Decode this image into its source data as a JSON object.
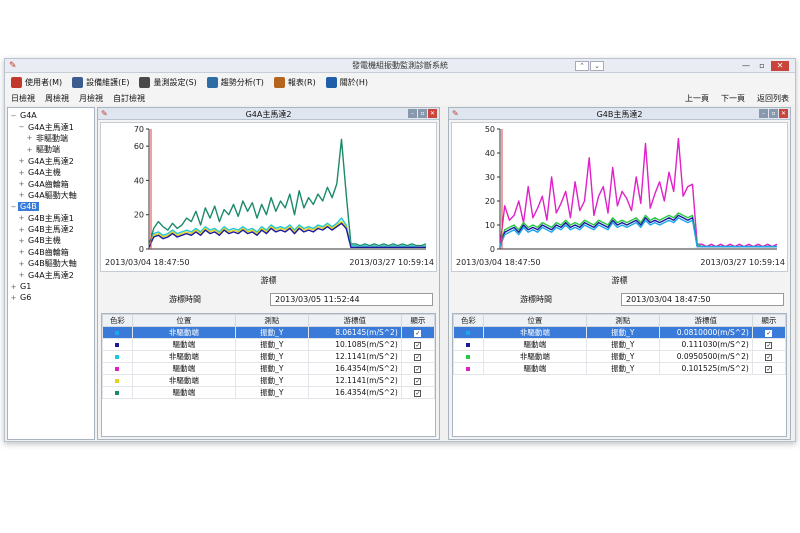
{
  "window": {
    "title": "發電機組振動監測診斷系統",
    "controls": {
      "minimize": "—",
      "restore": "▫",
      "close": "✕"
    }
  },
  "menu": [
    {
      "label": "使用者(M)",
      "icon": "user-icon",
      "color": "#c0392b"
    },
    {
      "label": "設備維護(E)",
      "icon": "monitor-icon",
      "color": "#3b5c8f"
    },
    {
      "label": "量測設定(S)",
      "icon": "settings-icon",
      "color": "#4a4a4a"
    },
    {
      "label": "趨勢分析(T)",
      "icon": "trend-icon",
      "color": "#2e6da4"
    },
    {
      "label": "報表(R)",
      "icon": "report-icon",
      "color": "#b5651d"
    },
    {
      "label": "關於(H)",
      "icon": "info-icon",
      "color": "#1f5fa8"
    }
  ],
  "toolbar": {
    "left": [
      "日檢視",
      "周檢視",
      "月檢視",
      "自訂檢視"
    ],
    "right": [
      "上一頁",
      "下一頁",
      "返回列表"
    ]
  },
  "tree": [
    {
      "label": "G4A",
      "level": 0,
      "exp": "−"
    },
    {
      "label": "G4A主馬達1",
      "level": 1,
      "exp": "−"
    },
    {
      "label": "非驅動端",
      "level": 2,
      "exp": "+"
    },
    {
      "label": "驅動端",
      "level": 2,
      "exp": "+"
    },
    {
      "label": "G4A主馬達2",
      "level": 1,
      "exp": "+"
    },
    {
      "label": "G4A主機",
      "level": 1,
      "exp": "+"
    },
    {
      "label": "G4A齒輪箱",
      "level": 1,
      "exp": "+"
    },
    {
      "label": "G4A驅動大軸",
      "level": 1,
      "exp": "+"
    },
    {
      "label": "G4B",
      "level": 0,
      "exp": "−",
      "selected": true
    },
    {
      "label": "G4B主馬達1",
      "level": 1,
      "exp": "+"
    },
    {
      "label": "G4B主馬達2",
      "level": 1,
      "exp": "+"
    },
    {
      "label": "G4B主機",
      "level": 1,
      "exp": "+"
    },
    {
      "label": "G4B齒輪箱",
      "level": 1,
      "exp": "+"
    },
    {
      "label": "G4B驅動大軸",
      "level": 1,
      "exp": "+"
    },
    {
      "label": "G4A主馬達2",
      "level": 1,
      "exp": "+"
    },
    {
      "label": "G1",
      "level": 0,
      "exp": "+"
    },
    {
      "label": "G6",
      "level": 0,
      "exp": "+"
    }
  ],
  "panels": [
    {
      "title": "G4A主馬達2",
      "cursor_label": "游標",
      "cursor_time_label": "游標時間",
      "cursor_time": "2013/03/05 11:52:44",
      "columns": [
        "色彩",
        "位置",
        "測點",
        "游標值",
        "顯示"
      ],
      "rows": [
        {
          "color": "#1ea7e8",
          "position": "非驅動端",
          "point": "振動_Y",
          "value": "8.06145(m/S^2)",
          "checked": true,
          "selected": true
        },
        {
          "color": "#1a1aa0",
          "position": "驅動端",
          "point": "振動_Y",
          "value": "10.1085(m/S^2)",
          "checked": true
        },
        {
          "color": "#1ec8d8",
          "position": "非驅動端",
          "point": "振動_Y",
          "value": "12.1141(m/S^2)",
          "checked": true
        },
        {
          "color": "#e020c8",
          "position": "驅動端",
          "point": "振動_Y",
          "value": "16.4354(m/S^2)",
          "checked": true
        },
        {
          "color": "#e8d020",
          "position": "非驅動端",
          "point": "振動_Y",
          "value": "12.1141(m/S^2)",
          "checked": true
        },
        {
          "color": "#1a8a6a",
          "position": "驅動端",
          "point": "振動_Y",
          "value": "16.4354(m/S^2)",
          "checked": true
        }
      ]
    },
    {
      "title": "G4B主馬達2",
      "cursor_label": "游標",
      "cursor_time_label": "游標時間",
      "cursor_time": "2013/03/04 18:47:50",
      "columns": [
        "色彩",
        "位置",
        "測點",
        "游標值",
        "顯示"
      ],
      "rows": [
        {
          "color": "#1ea7e8",
          "position": "非驅動端",
          "point": "振動_Y",
          "value": "0.0810000(m/S^2)",
          "checked": true,
          "selected": true
        },
        {
          "color": "#1a1aa0",
          "position": "驅動端",
          "point": "振動_Y",
          "value": "0.111030(m/S^2)",
          "checked": true
        },
        {
          "color": "#28c840",
          "position": "非驅動端",
          "point": "振動_Y",
          "value": "0.0950500(m/S^2)",
          "checked": true
        },
        {
          "color": "#e020c8",
          "position": "驅動端",
          "point": "振動_Y",
          "value": "0.101525(m/S^2)",
          "checked": true
        }
      ]
    }
  ],
  "chart_data": [
    {
      "type": "line",
      "title": "G4A主馬達2",
      "ylim": [
        0,
        70
      ],
      "yticks": [
        0,
        20,
        40,
        60,
        70
      ],
      "xlim": [
        "2013/03/04 18:47:50",
        "2013/03/27 10:59:14"
      ],
      "cursor_x": 0.0,
      "grid": false,
      "series": [
        {
          "color": "#1a8a6a",
          "values": [
            2,
            12,
            16,
            13,
            11,
            15,
            12,
            14,
            18,
            16,
            22,
            14,
            24,
            18,
            25,
            16,
            23,
            20,
            26,
            19,
            28,
            22,
            27,
            18,
            26,
            20,
            30,
            22,
            28,
            24,
            32,
            20,
            34,
            24,
            30,
            26,
            32,
            28,
            36,
            30,
            38,
            64,
            32,
            3,
            3,
            2,
            3,
            2,
            3,
            2,
            3,
            2,
            3,
            2,
            3,
            2,
            3,
            2,
            2,
            3
          ]
        },
        {
          "color": "#1ec8d8",
          "values": [
            1,
            9,
            10,
            8,
            9,
            11,
            9,
            10,
            11,
            10,
            12,
            10,
            13,
            11,
            12,
            10,
            13,
            11,
            12,
            11,
            13,
            11,
            12,
            10,
            13,
            11,
            14,
            12,
            13,
            12,
            14,
            11,
            14,
            12,
            13,
            12,
            14,
            13,
            15,
            13,
            15,
            18,
            14,
            2,
            2,
            1,
            2,
            1,
            2,
            1,
            2,
            1,
            2,
            1,
            2,
            1,
            2,
            1,
            1,
            2
          ]
        },
        {
          "color": "#e8d020",
          "values": [
            1,
            8,
            9,
            7,
            8,
            10,
            8,
            9,
            10,
            9,
            11,
            9,
            12,
            10,
            11,
            9,
            12,
            10,
            11,
            10,
            12,
            10,
            11,
            9,
            12,
            10,
            13,
            11,
            12,
            11,
            13,
            10,
            13,
            11,
            12,
            11,
            13,
            12,
            14,
            12,
            14,
            16,
            13,
            1,
            1,
            1,
            1,
            1,
            1,
            1,
            1,
            1,
            1,
            1,
            1,
            1,
            1,
            1,
            1,
            1
          ]
        },
        {
          "color": "#1a1aa0",
          "values": [
            1,
            7,
            8,
            6,
            7,
            9,
            7,
            8,
            9,
            8,
            10,
            8,
            11,
            9,
            10,
            8,
            11,
            9,
            10,
            9,
            11,
            9,
            10,
            8,
            11,
            9,
            12,
            10,
            11,
            10,
            12,
            9,
            12,
            10,
            11,
            10,
            12,
            11,
            13,
            11,
            13,
            15,
            12,
            1,
            1,
            1,
            1,
            1,
            1,
            1,
            1,
            1,
            1,
            1,
            1,
            1,
            1,
            1,
            1,
            1
          ]
        }
      ]
    },
    {
      "type": "line",
      "title": "G4B主馬達2",
      "ylim": [
        0,
        50
      ],
      "yticks": [
        0,
        10,
        20,
        30,
        40,
        50
      ],
      "xlim": [
        "2013/03/04 18:47:50",
        "2013/03/27 10:59:14"
      ],
      "cursor_x": 0.0,
      "grid": false,
      "series": [
        {
          "color": "#e020c8",
          "values": [
            1,
            18,
            12,
            14,
            20,
            11,
            26,
            13,
            17,
            22,
            12,
            30,
            15,
            19,
            24,
            13,
            28,
            16,
            20,
            38,
            14,
            22,
            26,
            15,
            34,
            18,
            24,
            21,
            16,
            30,
            19,
            44,
            17,
            23,
            28,
            20,
            32,
            24,
            46,
            22,
            26,
            27,
            2,
            2,
            1,
            2,
            1,
            2,
            1,
            2,
            1,
            2,
            1,
            2,
            1,
            2,
            1,
            2,
            1,
            2
          ]
        },
        {
          "color": "#28c840",
          "values": [
            1,
            8,
            9,
            10,
            8,
            11,
            9,
            10,
            9,
            11,
            10,
            9,
            11,
            10,
            12,
            10,
            11,
            10,
            12,
            11,
            10,
            12,
            11,
            10,
            13,
            11,
            12,
            11,
            12,
            13,
            11,
            14,
            12,
            13,
            12,
            13,
            14,
            13,
            15,
            14,
            13,
            14,
            2,
            1,
            1,
            1,
            1,
            1,
            1,
            1,
            1,
            1,
            1,
            1,
            1,
            1,
            1,
            1,
            1,
            1
          ]
        },
        {
          "color": "#1a1aa0",
          "values": [
            1,
            7,
            8,
            9,
            7,
            10,
            8,
            9,
            8,
            10,
            9,
            8,
            10,
            9,
            11,
            9,
            10,
            9,
            11,
            10,
            9,
            11,
            10,
            9,
            12,
            10,
            11,
            10,
            11,
            12,
            10,
            13,
            11,
            12,
            11,
            12,
            13,
            12,
            14,
            13,
            12,
            13,
            1,
            1,
            1,
            1,
            1,
            1,
            1,
            1,
            1,
            1,
            1,
            1,
            1,
            1,
            1,
            1,
            1,
            1
          ]
        },
        {
          "color": "#1ea7e8",
          "values": [
            1,
            6,
            7,
            8,
            6,
            9,
            7,
            8,
            7,
            9,
            8,
            7,
            9,
            8,
            10,
            8,
            9,
            8,
            10,
            9,
            8,
            10,
            9,
            8,
            11,
            9,
            10,
            9,
            10,
            11,
            9,
            12,
            10,
            11,
            10,
            11,
            12,
            11,
            13,
            12,
            11,
            12,
            1,
            1,
            1,
            1,
            1,
            1,
            1,
            1,
            1,
            1,
            1,
            1,
            1,
            1,
            1,
            1,
            1,
            1
          ]
        }
      ]
    }
  ]
}
